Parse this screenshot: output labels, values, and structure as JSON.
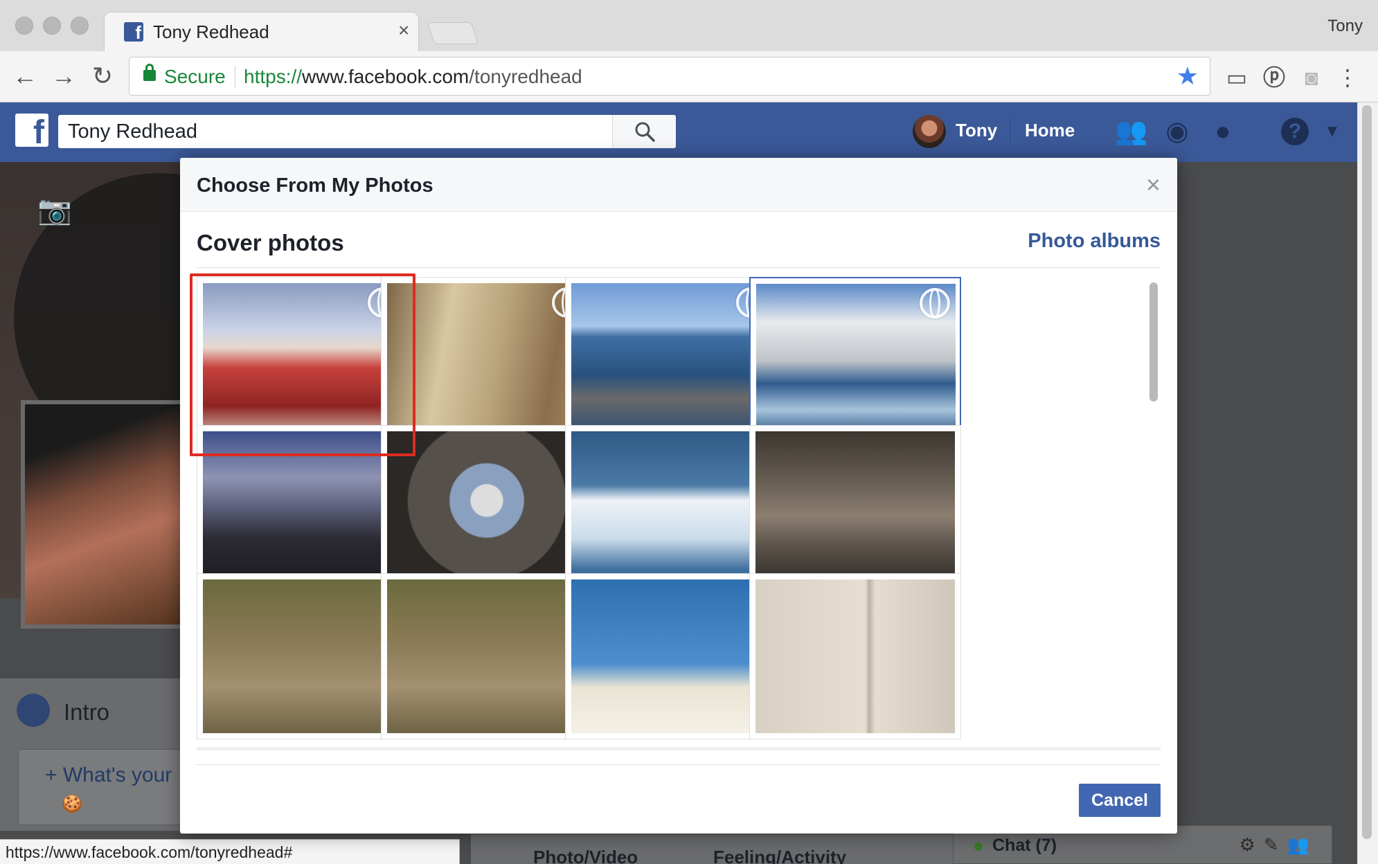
{
  "browser": {
    "tab_title": "Tony Redhead",
    "profile_name": "Tony",
    "address": {
      "secure_label": "Secure",
      "scheme": "https://",
      "host": "www.facebook.com",
      "path": "/tonyredhead"
    },
    "status_url": "https://www.facebook.com/tonyredhead#"
  },
  "facebook": {
    "search_value": "Tony Redhead",
    "user_name": "Tony",
    "home_label": "Home",
    "intro_label": "Intro",
    "intro_prompt": "What's your",
    "composer": {
      "photo_video": "Photo/Video",
      "feeling_activity": "Feeling/Activity"
    },
    "chat_label": "Chat (7)",
    "brand_color": "#3b5998"
  },
  "dialog": {
    "title": "Choose From My Photos",
    "section_title": "Cover photos",
    "albums_link": "Photo albums",
    "cancel_label": "Cancel",
    "accent_color": "#4267b2",
    "highlight_color": "#dd2b20",
    "photos": [
      {
        "subject": "red-truck",
        "panorama": true,
        "highlighted": true
      },
      {
        "subject": "wall-mural",
        "panorama": true
      },
      {
        "subject": "zodiac-boat",
        "panorama": true
      },
      {
        "subject": "cruise-ship",
        "panorama": true,
        "selected": true
      },
      {
        "subject": "volcano"
      },
      {
        "subject": "tiny-planet"
      },
      {
        "subject": "iceberg"
      },
      {
        "subject": "sea-lions"
      },
      {
        "subject": "komodo-dragon"
      },
      {
        "subject": "komodo-dragon"
      },
      {
        "subject": "beach-photographer"
      },
      {
        "subject": "painted-numbers"
      }
    ]
  }
}
